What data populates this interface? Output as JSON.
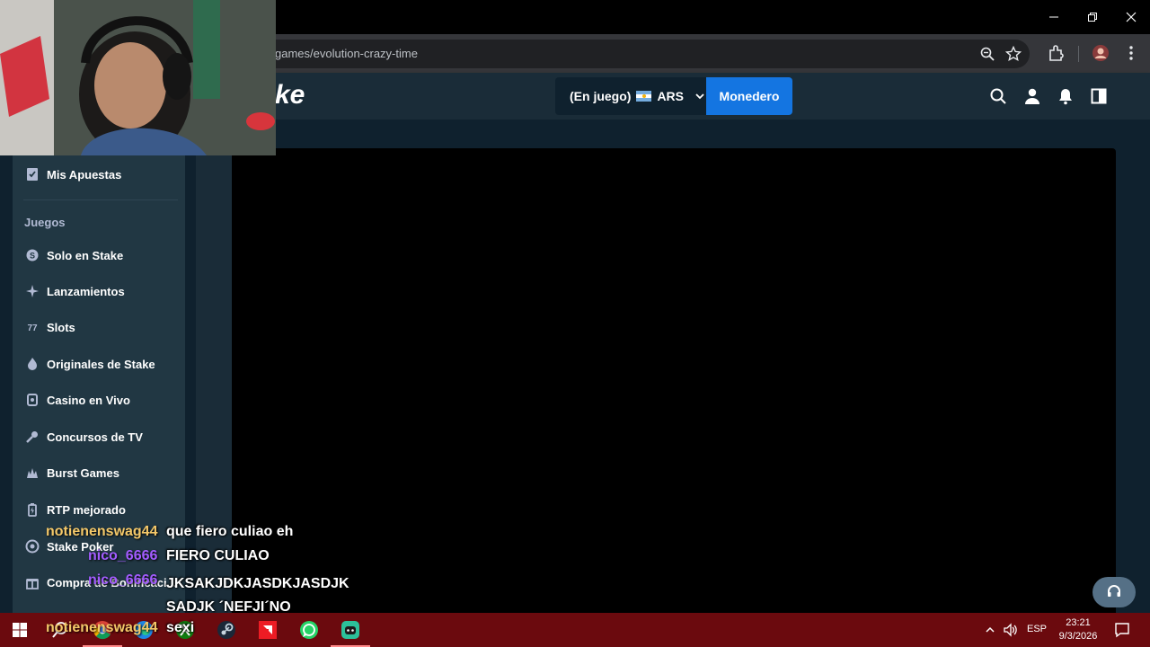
{
  "browser": {
    "url": "games/evolution-crazy-time",
    "window_controls": [
      "minimize",
      "restore",
      "close"
    ]
  },
  "header": {
    "logo_fragment": "ke",
    "balance_label": "(En juego)",
    "currency": "ARS",
    "wallet_button": "Monedero"
  },
  "sidebar": {
    "top_item": "Mis Apuestas",
    "section_title": "Juegos",
    "items": [
      {
        "label": "Solo en Stake",
        "icon": "stake-badge-icon"
      },
      {
        "label": "Lanzamientos",
        "icon": "sparkle-icon"
      },
      {
        "label": "Slots",
        "icon": "slots-icon"
      },
      {
        "label": "Originales de Stake",
        "icon": "flame-icon"
      },
      {
        "label": "Casino en Vivo",
        "icon": "live-casino-icon"
      },
      {
        "label": "Concursos de TV",
        "icon": "microphone-icon"
      },
      {
        "label": "Burst Games",
        "icon": "burst-icon"
      },
      {
        "label": "RTP mejorado",
        "icon": "battery-icon"
      },
      {
        "label": "Stake Poker",
        "icon": "poker-chip-icon"
      },
      {
        "label": "Compra de Bonificaci...",
        "icon": "gift-icon"
      }
    ]
  },
  "chat": {
    "messages": [
      {
        "user": "notienenswag44",
        "user_color": "#f4c869",
        "text": "que fiero culiao eh"
      },
      {
        "user": "nico_6666",
        "user_color": "#a35cff",
        "text": "FIERO CULIAO"
      },
      {
        "user": "nico_6666",
        "user_color": "#a35cff",
        "text": "JKSAKJDKJASDKJASDJK SADJK ´NEFJI´NO"
      },
      {
        "user": "notienenswag44",
        "user_color": "#f4c869",
        "text": "sexi"
      }
    ]
  },
  "taskbar": {
    "apps": [
      "search-icon",
      "chrome-icon",
      "edge-icon",
      "xbox-icon",
      "steam-icon",
      "amd-icon",
      "whatsapp-icon",
      "discord-icon"
    ],
    "language": "ESP",
    "time": "23:21",
    "date": "9/3/2026"
  }
}
